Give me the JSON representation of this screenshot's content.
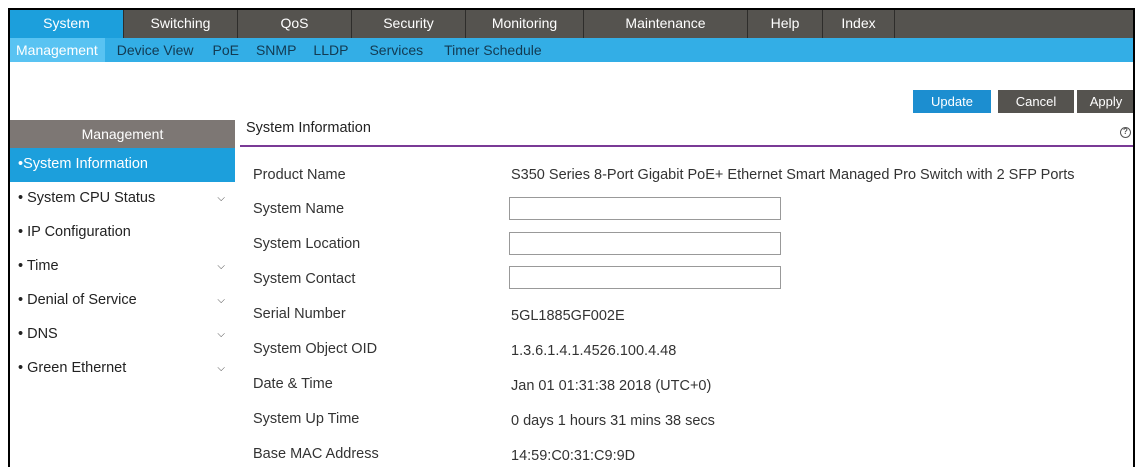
{
  "topnav": {
    "tabs": [
      {
        "label": "System",
        "active": true
      },
      {
        "label": "Switching",
        "active": false
      },
      {
        "label": "QoS",
        "active": false
      },
      {
        "label": "Security",
        "active": false
      },
      {
        "label": "Monitoring",
        "active": false
      },
      {
        "label": "Maintenance",
        "active": false
      },
      {
        "label": "Help",
        "active": false
      },
      {
        "label": "Index",
        "active": false
      },
      {
        "label": "",
        "active": false
      }
    ]
  },
  "subnav": {
    "items": [
      {
        "label": "Management",
        "active": true
      },
      {
        "label": "Device View",
        "active": false
      },
      {
        "label": "PoE",
        "active": false
      },
      {
        "label": "SNMP",
        "active": false
      },
      {
        "label": "LLDP",
        "active": false
      },
      {
        "label": "Services",
        "active": false
      },
      {
        "label": "Timer Schedule",
        "active": false
      }
    ]
  },
  "actions": {
    "update": "Update",
    "cancel": "Cancel",
    "apply": "Apply"
  },
  "sidebar": {
    "header": "Management",
    "items": [
      {
        "label": "System Information",
        "active": true,
        "expandable": false
      },
      {
        "label": "System CPU Status",
        "active": false,
        "expandable": true
      },
      {
        "label": "IP Configuration",
        "active": false,
        "expandable": false
      },
      {
        "label": "Time",
        "active": false,
        "expandable": true
      },
      {
        "label": "Denial of Service",
        "active": false,
        "expandable": true
      },
      {
        "label": "DNS",
        "active": false,
        "expandable": true
      },
      {
        "label": "Green Ethernet",
        "active": false,
        "expandable": true
      }
    ]
  },
  "content": {
    "title": "System Information",
    "help_icon": "help-circle-icon",
    "fields": {
      "product_name": {
        "label": "Product Name",
        "value": "S350 Series 8-Port Gigabit PoE+ Ethernet Smart Managed Pro Switch with 2 SFP Ports"
      },
      "system_name": {
        "label": "System Name",
        "value": ""
      },
      "system_location": {
        "label": "System Location",
        "value": ""
      },
      "system_contact": {
        "label": "System Contact",
        "value": ""
      },
      "serial_number": {
        "label": "Serial Number",
        "value": "5GL1885GF002E"
      },
      "system_object_oid": {
        "label": "System Object OID",
        "value": "1.3.6.1.4.1.4526.100.4.48"
      },
      "date_time": {
        "label": "Date & Time",
        "value": "Jan 01 01:31:38 2018 (UTC+0)"
      },
      "system_up_time": {
        "label": "System Up Time",
        "value": "0 days 1 hours 31 mins 38 secs"
      },
      "base_mac_address": {
        "label": "Base MAC Address",
        "value": "14:59:C0:31:C9:9D"
      }
    }
  },
  "colors": {
    "topnav_bg": "#55534f",
    "active_blue": "#1c9fdc",
    "subnav_bg": "#33aee6",
    "accent_purple": "#7a3a96"
  }
}
